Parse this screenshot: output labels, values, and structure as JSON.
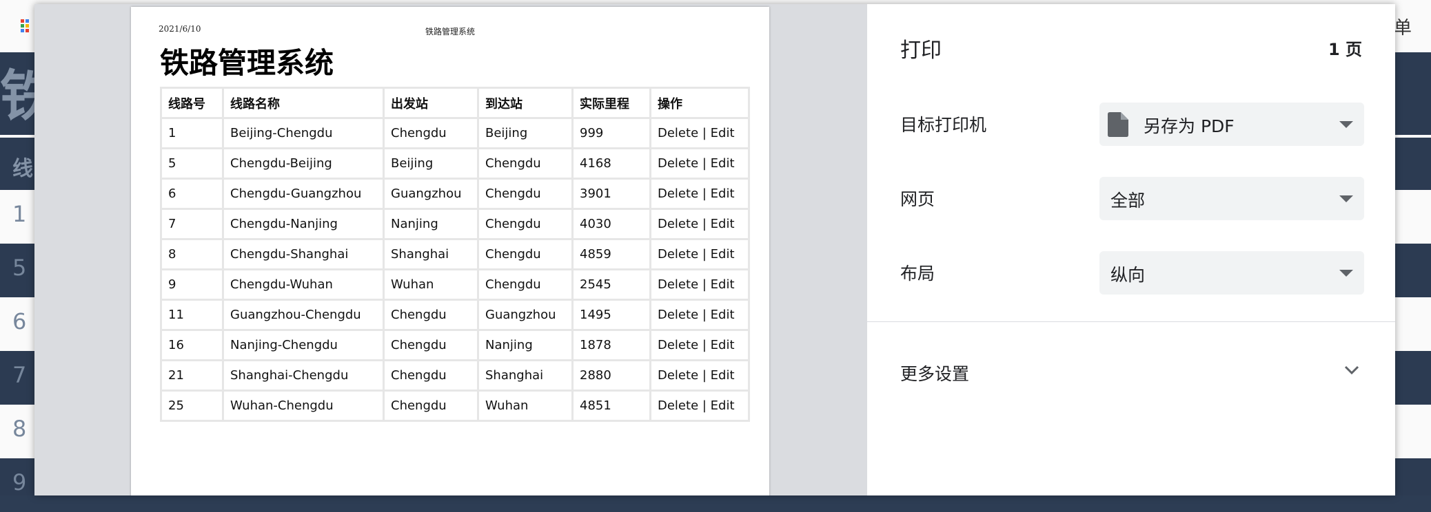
{
  "background": {
    "banner_title": "铁",
    "header_cell": "线",
    "right_char": "单",
    "row_numbers": [
      "1",
      "5",
      "6",
      "7",
      "8",
      "9"
    ]
  },
  "paper": {
    "header_date": "2021/6/10",
    "header_title": "铁路管理系统",
    "doc_title": "铁路管理系统",
    "columns": [
      "线路号",
      "线路名称",
      "出发站",
      "到达站",
      "实际里程",
      "操作"
    ],
    "rows": [
      [
        "1",
        "Beijing-Chengdu",
        "Chengdu",
        "Beijing",
        "999",
        "Delete | Edit"
      ],
      [
        "5",
        "Chengdu-Beijing",
        "Beijing",
        "Chengdu",
        "4168",
        "Delete | Edit"
      ],
      [
        "6",
        "Chengdu-Guangzhou",
        "Guangzhou",
        "Chengdu",
        "3901",
        "Delete | Edit"
      ],
      [
        "7",
        "Chengdu-Nanjing",
        "Nanjing",
        "Chengdu",
        "4030",
        "Delete | Edit"
      ],
      [
        "8",
        "Chengdu-Shanghai",
        "Shanghai",
        "Chengdu",
        "4859",
        "Delete | Edit"
      ],
      [
        "9",
        "Chengdu-Wuhan",
        "Wuhan",
        "Chengdu",
        "2545",
        "Delete | Edit"
      ],
      [
        "11",
        "Guangzhou-Chengdu",
        "Chengdu",
        "Guangzhou",
        "1495",
        "Delete | Edit"
      ],
      [
        "16",
        "Nanjing-Chengdu",
        "Chengdu",
        "Nanjing",
        "1878",
        "Delete | Edit"
      ],
      [
        "21",
        "Shanghai-Chengdu",
        "Chengdu",
        "Shanghai",
        "2880",
        "Delete | Edit"
      ],
      [
        "25",
        "Wuhan-Chengdu",
        "Chengdu",
        "Wuhan",
        "4851",
        "Delete | Edit"
      ]
    ]
  },
  "settings": {
    "title": "打印",
    "page_count": "1 页",
    "destination_label": "目标打印机",
    "destination_value": "另存为 PDF",
    "pages_label": "网页",
    "pages_value": "全部",
    "layout_label": "布局",
    "layout_value": "纵向",
    "more_settings": "更多设置"
  },
  "colors": {
    "dark_navy": "#2d3d54",
    "dialog_gray": "#dadce0",
    "select_bg": "#f1f3f4",
    "icon_gray": "#5f6368"
  }
}
